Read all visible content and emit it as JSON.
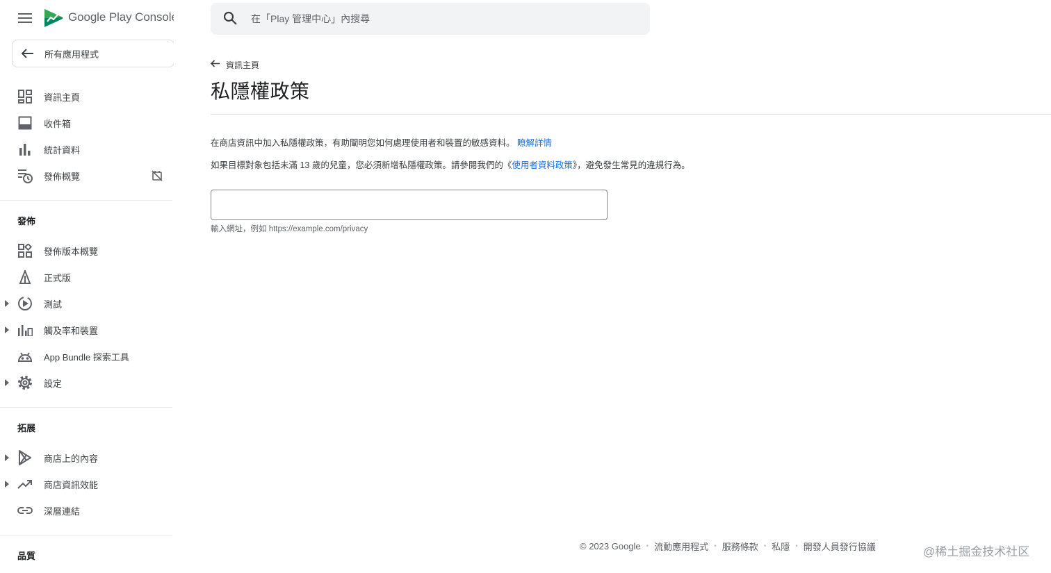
{
  "app": {
    "brand_google": "Google Play",
    "brand_console": "Console"
  },
  "search": {
    "placeholder": "在「Play 管理中心」內搜尋"
  },
  "sidebar": {
    "back_label": "所有應用程式",
    "items_top": [
      {
        "label": "資訊主頁",
        "icon": "dashboard-icon"
      },
      {
        "label": "收件箱",
        "icon": "inbox-icon"
      },
      {
        "label": "統計資料",
        "icon": "bar-chart-icon"
      },
      {
        "label": "發佈概覽",
        "icon": "publishing-overview-icon"
      }
    ],
    "section_release": "發佈",
    "items_release": [
      {
        "label": "發佈版本概覽",
        "icon": "releases-overview-icon"
      },
      {
        "label": "正式版",
        "icon": "production-icon"
      },
      {
        "label": "測試",
        "icon": "testing-icon"
      },
      {
        "label": "觸及率和裝置",
        "icon": "reach-devices-icon"
      },
      {
        "label": "App Bundle 探索工具",
        "icon": "android-icon"
      },
      {
        "label": "設定",
        "icon": "settings-icon"
      }
    ],
    "section_grow": "拓展",
    "items_grow": [
      {
        "label": "商店上的內容",
        "icon": "play-store-icon"
      },
      {
        "label": "商店資訊效能",
        "icon": "trending-up-icon"
      },
      {
        "label": "深層連結",
        "icon": "link-icon"
      }
    ],
    "section_quality": "品質"
  },
  "main": {
    "breadcrumb": "資訊主頁",
    "title": "私隱權政策",
    "desc1_text": "在商店資訊中加入私隱權政策，有助闡明您如何處理使用者和裝置的敏感資料。",
    "desc1_link": "瞭解詳情",
    "desc2_before": "如果目標對象包括未滿 13 歲的兒童，您必須新增私隱權政策。請參閱我們的《",
    "desc2_link": "使用者資料政策",
    "desc2_after": "》，避免發生常見的違規行為。",
    "url_value": "",
    "url_hint": "輸入網址，例如 https://example.com/privacy"
  },
  "footer": {
    "copyright": "© 2023 Google",
    "links": [
      "流動應用程式",
      "服務條款",
      "私隱",
      "開發人員發行協議"
    ]
  },
  "watermark": "@稀土掘金技术社区",
  "colors": {
    "accent": "#1a73e8",
    "icon": "#5f6368",
    "text": "#3c4043"
  }
}
